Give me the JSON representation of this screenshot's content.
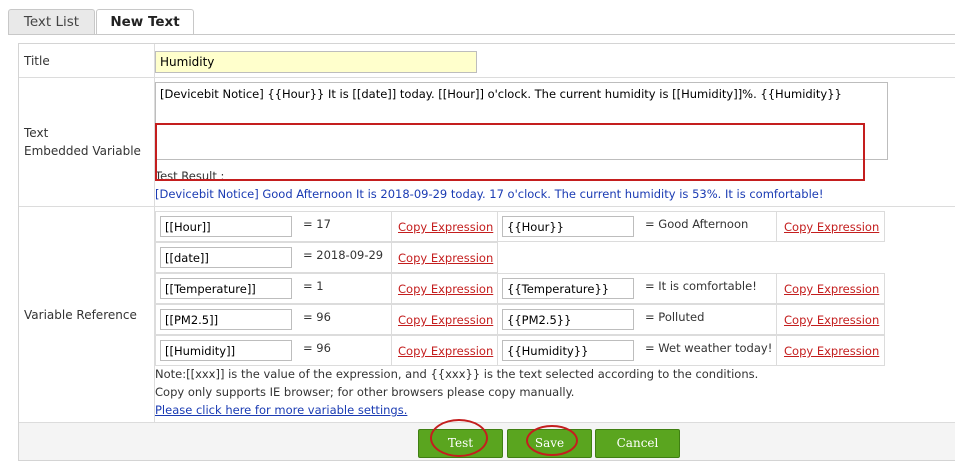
{
  "tabs": {
    "list": "Text List",
    "new": "New Text"
  },
  "form": {
    "title_label": "Title",
    "title_value": "Humidity",
    "text_label_1": "Text",
    "text_label_2": "Embedded Variable",
    "text_value": "[Devicebit Notice] {{Hour}} It is [[date]] today. [[Hour]] o'clock. The current humidity is [[Humidity]]%. {{Humidity}}",
    "test_result_label": "Test Result :",
    "test_result_value": "[Devicebit Notice] Good Afternoon It is 2018-09-29 today. 17 o'clock. The current humidity is 53%. It is comfortable!",
    "var_label": "Variable Reference"
  },
  "variables": [
    {
      "expr": "[[Hour]]",
      "eq": "= 17",
      "copy": "Copy Expression",
      "expr2": "{{Hour}}",
      "eq2": "= Good Afternoon",
      "copy2": "Copy Expression"
    },
    {
      "expr": "[[date]]",
      "eq": "= 2018-09-29",
      "copy": "Copy Expression"
    },
    {
      "expr": "[[Temperature]]",
      "eq": "= 1",
      "copy": "Copy Expression",
      "expr2": "{{Temperature}}",
      "eq2": "= It is comfortable!",
      "copy2": "Copy Expression"
    },
    {
      "expr": "[[PM2.5]]",
      "eq": "= 96",
      "copy": "Copy Expression",
      "expr2": "{{PM2.5}}",
      "eq2": "= Polluted",
      "copy2": "Copy Expression"
    },
    {
      "expr": "[[Humidity]]",
      "eq": "= 96",
      "copy": "Copy Expression",
      "expr2": "{{Humidity}}",
      "eq2": "= Wet weather today!",
      "copy2": "Copy Expression"
    }
  ],
  "notes": {
    "line1": "Note:[[xxx]] is the value of the expression, and {{xxx}} is the text selected according to the conditions.",
    "line2": "Copy only supports IE browser; for other browsers please copy manually.",
    "link": "Please click here for more variable settings."
  },
  "buttons": {
    "test": "Test",
    "save": "Save",
    "cancel": "Cancel"
  },
  "colors": {
    "accent_green": "#5aa51f",
    "highlight_red": "#c41e1e",
    "link_blue": "#1a3bb3"
  }
}
